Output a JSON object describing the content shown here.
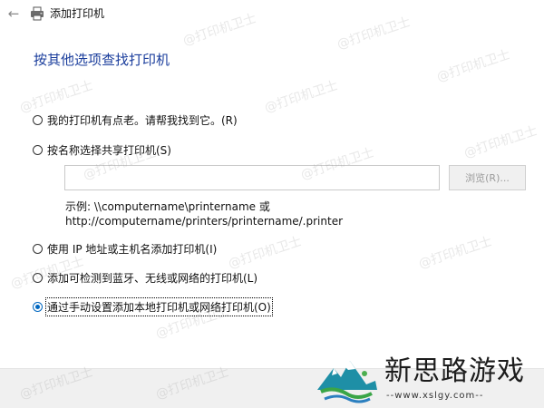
{
  "titlebar": {
    "back_icon": "back-arrow-icon",
    "app_icon": "printer-icon",
    "title": "添加打印机"
  },
  "heading": "按其他选项查找打印机",
  "options": [
    {
      "label": "我的打印机有点老。请帮我找到它。(R)",
      "checked": false
    },
    {
      "label": "按名称选择共享打印机(S)",
      "checked": false
    },
    {
      "label": "使用 IP 地址或主机名添加打印机(I)",
      "checked": false
    },
    {
      "label": "添加可检测到蓝牙、无线或网络的打印机(L)",
      "checked": false
    },
    {
      "label": "通过手动设置添加本地打印机或网络打印机(O)",
      "checked": true
    }
  ],
  "share_input": {
    "value": "",
    "placeholder": ""
  },
  "browse_button": "浏览(R)...",
  "example": {
    "line1": "示例: \\\\computername\\printername 或",
    "line2": "http://computername/printers/printername/.printer"
  },
  "watermark": "@打印机卫士",
  "logo": {
    "name": "新思路游戏",
    "url": "--www.xslgy.com--"
  },
  "colors": {
    "heading": "#1a3d9c",
    "radio_selected": "#0067c0",
    "bottom_bar": "#f0f0f0"
  }
}
